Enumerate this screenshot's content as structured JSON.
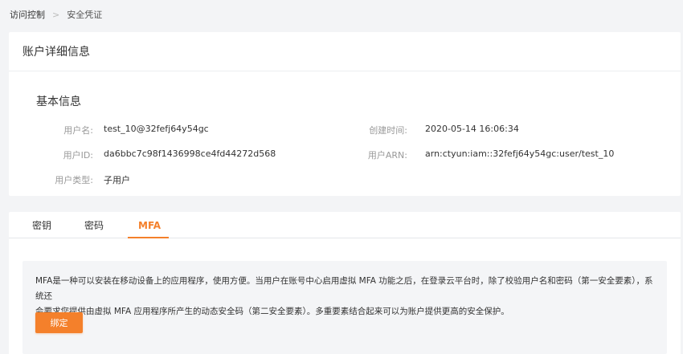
{
  "breadcrumb": {
    "parent": "访问控制",
    "current": "安全凭证"
  },
  "account_card": {
    "title": "账户详细信息",
    "section_title": "基本信息",
    "fields": {
      "username_label": "用户名:",
      "username_value": "test_10@32fefj64y54gc",
      "created_label": "创建时间:",
      "created_value": "2020-05-14 16:06:34",
      "userid_label": "用户ID:",
      "userid_value": "da6bbc7c98f1436998ce4fd44272d568",
      "arn_label": "用户ARN:",
      "arn_value": "arn:ctyun:iam::32fefj64y54gc:user/test_10",
      "usertype_label": "用户类型:",
      "usertype_value": "子用户"
    }
  },
  "tabs": [
    {
      "label": "密钥"
    },
    {
      "label": "密码"
    },
    {
      "label": "MFA"
    }
  ],
  "mfa": {
    "description_line1": "MFA是一种可以安装在移动设备上的应用程序，使用方便。当用户在账号中心启用虚拟 MFA 功能之后，在登录云平台时，除了校验用户名和密码（第一安全要素），系统还",
    "description_line2": "会要求您提供由虚拟 MFA 应用程序所产生的动态安全码（第二安全要素）。多重要素结合起来可以为账户提供更高的安全保护。",
    "bind_button": "绑定"
  },
  "colors": {
    "accent": "#f4802b",
    "background": "#f3f4f6",
    "info_box": "#f4f5f7"
  }
}
